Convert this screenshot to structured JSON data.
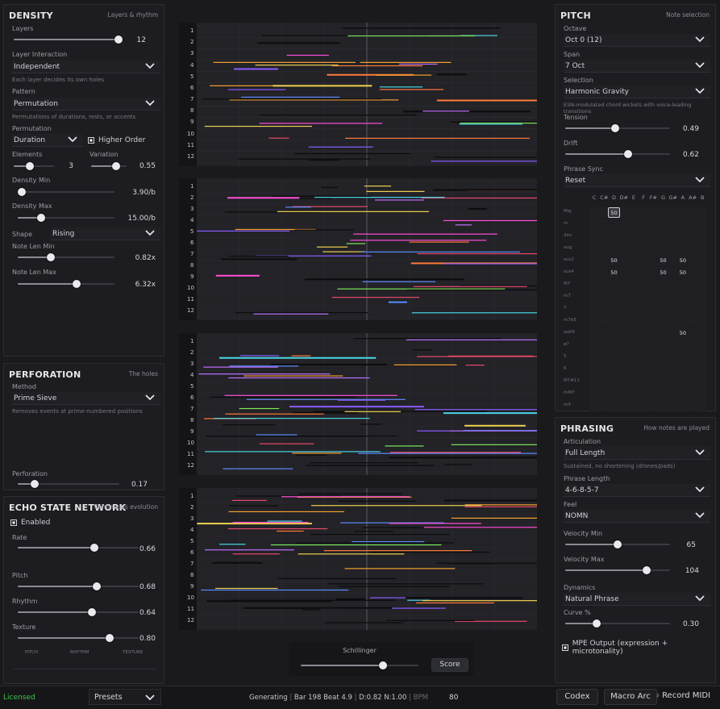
{
  "density": {
    "title": "DENSITY",
    "subtitle": "Layers & rhythm",
    "layers_label": "Layers",
    "layers_value": "12",
    "layer_interaction_label": "Layer Interaction",
    "layer_interaction_value": "Independent",
    "layer_interaction_hint": "Each layer decides its own holes",
    "pattern_label": "Pattern",
    "pattern_value": "Permutation",
    "pattern_hint": "Permutations of durations, rests, or accents",
    "permutation_label": "Permutation",
    "permutation_value": "Duration",
    "higher_order_label": "Higher Order",
    "elements_label": "Elements",
    "elements_value": "3",
    "variation_label": "Variation",
    "variation_value": "0.55",
    "density_min_label": "Density Min",
    "density_min_value": "3.90/b",
    "density_max_label": "Density Max",
    "density_max_value": "15.00/b",
    "shape_label": "Shape",
    "shape_value": "Rising",
    "note_len_min_label": "Note Len Min",
    "note_len_min_value": "0.82x",
    "note_len_max_label": "Note Len Max",
    "note_len_max_value": "6.32x"
  },
  "perforation": {
    "title": "PERFORATION",
    "subtitle": "The holes",
    "method_label": "Method",
    "method_value": "Prime Sieve",
    "method_hint": "Removes events at prime-numbered positions",
    "perforation_label": "Perforation",
    "perforation_value": "0.17"
  },
  "esn": {
    "title": "ECHO STATE NETWORK",
    "subtitle": "Continuous evolution",
    "enabled_label": "Enabled",
    "rate_label": "Rate",
    "rate_value": "0.66",
    "pitch_label": "Pitch",
    "pitch_value": "0.68",
    "rhythm_label": "Rhythm",
    "rhythm_value": "0.64",
    "texture_label": "Texture",
    "texture_value": "0.80",
    "mini_labels": [
      "PITCH",
      "RHYTHM",
      "TEXTURE"
    ]
  },
  "pitch": {
    "title": "PITCH",
    "subtitle": "Note selection",
    "octave_label": "Octave",
    "octave_value": "Oct 0 (12)",
    "span_label": "Span",
    "span_value": "7 Oct",
    "selection_label": "Selection",
    "selection_value": "Harmonic Gravity",
    "selection_hint": "ESN-modulated chord wickets with voice-leading transitions",
    "tension_label": "Tension",
    "tension_value": "0.49",
    "drift_label": "Drift",
    "drift_value": "0.62",
    "phrase_sync_label": "Phrase Sync",
    "phrase_sync_value": "Reset",
    "grid_columns": [
      "C",
      "C#",
      "D",
      "D#",
      "E",
      "F",
      "F#",
      "G",
      "G#",
      "A",
      "A#",
      "B"
    ],
    "grid_rows": [
      "Maj",
      "m",
      "dim",
      "aug",
      "sus2",
      "sus4",
      "M7",
      "m7",
      "7",
      "m7b5",
      "add9",
      "ø7",
      "5",
      "6",
      "M7#11",
      "mM7",
      "m9"
    ],
    "grid_cells": [
      {
        "row": 0,
        "col": 2,
        "text": "50",
        "selected": true
      },
      {
        "row": 4,
        "col": 2,
        "text": "50"
      },
      {
        "row": 4,
        "col": 7,
        "text": "50"
      },
      {
        "row": 4,
        "col": 9,
        "text": "50"
      },
      {
        "row": 5,
        "col": 2,
        "text": "50"
      },
      {
        "row": 5,
        "col": 7,
        "text": "50"
      },
      {
        "row": 5,
        "col": 9,
        "text": "50"
      },
      {
        "row": 10,
        "col": 9,
        "text": "50"
      }
    ]
  },
  "phrasing": {
    "title": "PHRASING",
    "subtitle": "How notes are played",
    "articulation_label": "Articulation",
    "articulation_value": "Full Length",
    "articulation_hint": "Sustained, no shortening (drones/pads)",
    "phrase_length_label": "Phrase Length",
    "phrase_length_value": "4-6-8-5-7",
    "feel_label": "Feel",
    "feel_value": "NOMN",
    "vel_min_label": "Velocity Min",
    "vel_min_value": "65",
    "vel_max_label": "Velocity Max",
    "vel_max_value": "104",
    "dynamics_label": "Dynamics",
    "dynamics_value": "Natural Phrase",
    "curve_label": "Curve %",
    "curve_value": "0.30",
    "mpe_label": "MPE Output (expression + microtonality)"
  },
  "rolls": {
    "row_numbers": [
      "1",
      "2",
      "3",
      "4",
      "5",
      "6",
      "7",
      "8",
      "9",
      "10",
      "11",
      "12"
    ]
  },
  "schillinger": {
    "label": "Schillinger",
    "score_button": "Score"
  },
  "status": {
    "licensed": "Licensed",
    "presets": "Presets",
    "generating": "Generating",
    "bar": "Bar 198 Beat 4.9",
    "d_n": "D:0.82 N:1.00",
    "bpm_label": "BPM",
    "bpm_value": "80",
    "codex": "Codex",
    "macro_arc": "Macro Arc",
    "record_midi": "Record MIDI"
  },
  "colors": {
    "accent_green": "#3fc24a",
    "note_palette": [
      "#8a5cff",
      "#4ad6e8",
      "#f0d050",
      "#ff4fd8",
      "#ff7a3a",
      "#5b8cff",
      "#e84a6a",
      "#7ee85a",
      "#c070ff",
      "#f5a030"
    ]
  }
}
